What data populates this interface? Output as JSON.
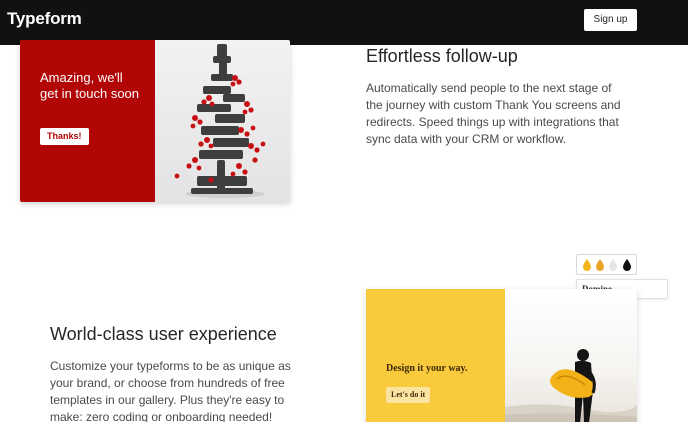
{
  "nav": {
    "logo": "Typeform",
    "signup_label": "Sign up"
  },
  "section_followup": {
    "title": "Effortless follow-up",
    "body": "Automatically send people to the next stage of the journey with custom Thank You screens and redirects. Speed things up with integrations that sync data with your CRM or workflow.",
    "card": {
      "message": "Amazing, we'll get in touch soon",
      "button_label": "Thanks!",
      "accent": "#b20505"
    }
  },
  "theme_tools": {
    "swatch_colors": [
      "#f3b51c",
      "#e8a52a",
      "#e6e6e6",
      "#111111"
    ],
    "font_name": "Domine"
  },
  "section_experience": {
    "title": "World-class user experience",
    "body": "Customize your typeforms to be as unique as your brand, or choose from hundreds of free templates in our gallery. Plus they're easy to make: zero coding or onboarding needed!",
    "card": {
      "title": "Design it your way.",
      "button_label": "Let's do it",
      "accent": "#f9ca3b"
    }
  }
}
